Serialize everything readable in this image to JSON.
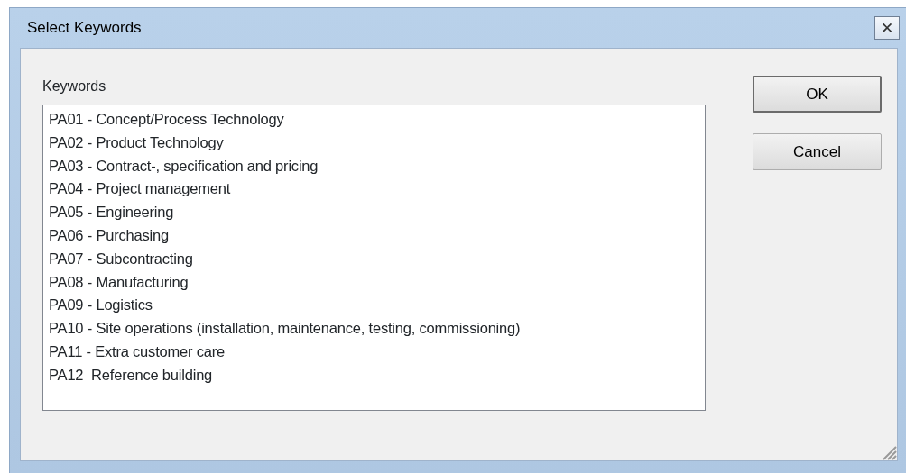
{
  "window": {
    "title": "Select Keywords",
    "close_glyph": "✕"
  },
  "keywords": {
    "label": "Keywords",
    "items": [
      {
        "text": "PA01 - Concept/Process Technology",
        "selected": false
      },
      {
        "text": "PA02 - Product Technology",
        "selected": false
      },
      {
        "text": "PA03 - Contract-, specification and pricing",
        "selected": false
      },
      {
        "text": "PA04 - Project management",
        "selected": false
      },
      {
        "text": "PA05 - Engineering",
        "selected": false
      },
      {
        "text": "PA06 - Purchasing",
        "selected": false
      },
      {
        "text": "PA07 - Subcontracting",
        "selected": false
      },
      {
        "text": "PA08 - Manufacturing",
        "selected": false
      },
      {
        "text": "PA09 - Logistics",
        "selected": false
      },
      {
        "text": "PA10 - Site operations (installation, maintenance, testing, commissioning)",
        "selected": false
      },
      {
        "text": "PA11 - Extra customer care",
        "selected": false
      },
      {
        "text": "PA12  Reference building",
        "selected": false
      }
    ]
  },
  "buttons": [
    {
      "label": "OK",
      "default": true
    },
    {
      "label": "Cancel",
      "default": false
    }
  ]
}
